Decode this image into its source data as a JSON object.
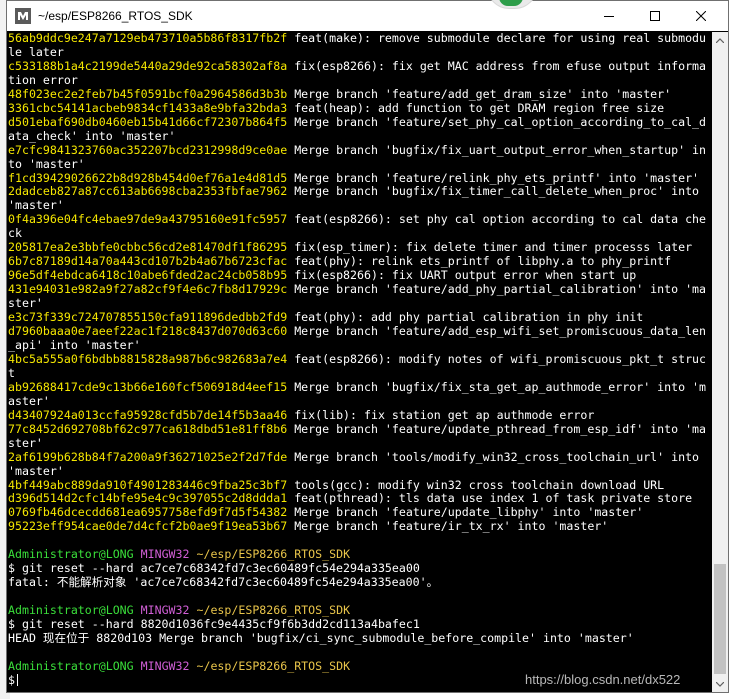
{
  "window": {
    "title": "~/esp/ESP8266_RTOS_SDK",
    "controls": {
      "minimize": "minimize-icon",
      "maximize": "maximize-icon",
      "close": "close-icon"
    }
  },
  "colors": {
    "background": "#000000",
    "hash": "#f5e700",
    "message": "#ffffff",
    "prompt_user": "#3adf3a",
    "prompt_env": "#d15fd6",
    "prompt_path": "#e8c44a"
  },
  "log": [
    {
      "hash": "56ab9ddc9e247a7129eb473710a5b86f8317fb2f",
      "msg": "feat(make): remove submodule declare for using real submodule later"
    },
    {
      "hash": "c533188b1a4c2199de5440a29de92ca58302af8a",
      "msg": "fix(esp8266): fix get MAC address from efuse output information error"
    },
    {
      "hash": "48f023ec2e2feb7b45f0591bcf0a2964586d3b3b",
      "msg": "Merge branch 'feature/add_get_dram_size' into 'master'"
    },
    {
      "hash": "3361cbc54141acbeb9834cf1433a8e9bfa32bda3",
      "msg": "feat(heap): add function to get DRAM region free size"
    },
    {
      "hash": "d501ebaf690db0460eb15b41d66cf72307b864f5",
      "msg": "Merge branch 'feature/set_phy_cal_option_according_to_cal_data_check' into 'master'"
    },
    {
      "hash": "e7cfc9841323760ac352207bcd2312998d9ce0ae",
      "msg": "Merge branch 'bugfix/fix_uart_output_error_when_startup' into 'master'"
    },
    {
      "hash": "f1cd39429026622b8d928b454d0ef76a1e4d81d5",
      "msg": "Merge branch 'feature/relink_phy_ets_printf' into 'master'"
    },
    {
      "hash": "2dadceb827a87cc613ab6698cba2353fbfae7962",
      "msg": "Merge branch 'bugfix/fix_timer_call_delete_when_proc' into 'master'"
    },
    {
      "hash": "0f4a396e04fc4ebae97de9a43795160e91fc5957",
      "msg": "feat(esp8266): set phy cal option according to cal data check"
    },
    {
      "hash": "205817ea2e3bbfe0cbbc56cd2e81470df1f86295",
      "msg": "fix(esp_timer): fix delete timer and timer processs later"
    },
    {
      "hash": "6b7c87189d14a70a443cd107b2b4a67b6723cfac",
      "msg": "feat(phy): relink ets_printf of libphy.a to phy_printf"
    },
    {
      "hash": "96e5df4ebdca6418c10abe6fded2ac24cb058b95",
      "msg": "fix(esp8266): fix UART output error when start up"
    },
    {
      "hash": "431e94031e982a9f27a82cf9f4e6c7fb8d17929c",
      "msg": "Merge branch 'feature/add_phy_partial_calibration' into 'master'"
    },
    {
      "hash": "e3c73f339c724707855150cfa911896dedbb2fd9",
      "msg": "feat(phy): add phy partial calibration in phy init"
    },
    {
      "hash": "d7960baaa0e7aeef22ac1f218c8437d070d63c60",
      "msg": "Merge branch 'feature/add_esp_wifi_set_promiscuous_data_len_api' into 'master'"
    },
    {
      "hash": "4bc5a555a0f6bdbb8815828a987b6c982683a7e4",
      "msg": "feat(esp8266): modify notes of wifi_promiscuous_pkt_t struct"
    },
    {
      "hash": "ab92688417cde9c13b66e160fcf506918d4eef15",
      "msg": "Merge branch 'bugfix/fix_sta_get_ap_authmode_error' into 'master'"
    },
    {
      "hash": "d43407924a013ccfa95928cfd5b7de14f5b3aa46",
      "msg": "fix(lib): fix station get ap authmode error"
    },
    {
      "hash": "77c8452d692708bf62c977ca618dbd51e81ff8b6",
      "msg": "Merge branch 'feature/update_pthread_from_esp_idf' into 'master'"
    },
    {
      "hash": "2af6199b628b84f7a200a9f36271025e2f2d7fde",
      "msg": "Merge branch 'tools/modify_win32_cross_toolchain_url' into 'master'"
    },
    {
      "hash": "4bf449abc889da910f4901283446c9fba25c3bf7",
      "msg": "tools(gcc): modify win32 cross toolchain download URL"
    },
    {
      "hash": "d396d514d2cfc14bfe95e4c9c397055c2d8ddda1",
      "msg": "feat(pthread): tls data use index 1 of task private store"
    },
    {
      "hash": "0769fb46dcecdd681ea6957758efd9f7d5f54382",
      "msg": "Merge branch 'feature/update_libphy' into 'master'"
    },
    {
      "hash": "95223eff954cae0de7d4cfcf2b0ae9f19ea53b67",
      "msg": "Merge branch 'feature/ir_tx_rx' into 'master'"
    }
  ],
  "session": [
    {
      "prompt": {
        "user": "Administrator@LONG",
        "env": "MINGW32",
        "path": "~/esp/ESP8266_RTOS_SDK"
      },
      "command": "$ git reset --hard ac7ce7c68342fd7c3ec60489fc54e294a335ea00",
      "output": "fatal: 不能解析对象 'ac7ce7c68342fd7c3ec60489fc54e294a335ea00'。"
    },
    {
      "prompt": {
        "user": "Administrator@LONG",
        "env": "MINGW32",
        "path": "~/esp/ESP8266_RTOS_SDK"
      },
      "command": "$ git reset --hard 8820d1036fc9e4435cf9f6b3dd2cd113a4bafec1",
      "output": "HEAD 现在位于 8820d103 Merge branch 'bugfix/ci_sync_submodule_before_compile' into 'master'"
    }
  ],
  "current_prompt": {
    "user": "Administrator@LONG",
    "env": "MINGW32",
    "path": "~/esp/ESP8266_RTOS_SDK",
    "symbol": "$"
  },
  "watermark": "https://blog.csdn.net/dx522"
}
